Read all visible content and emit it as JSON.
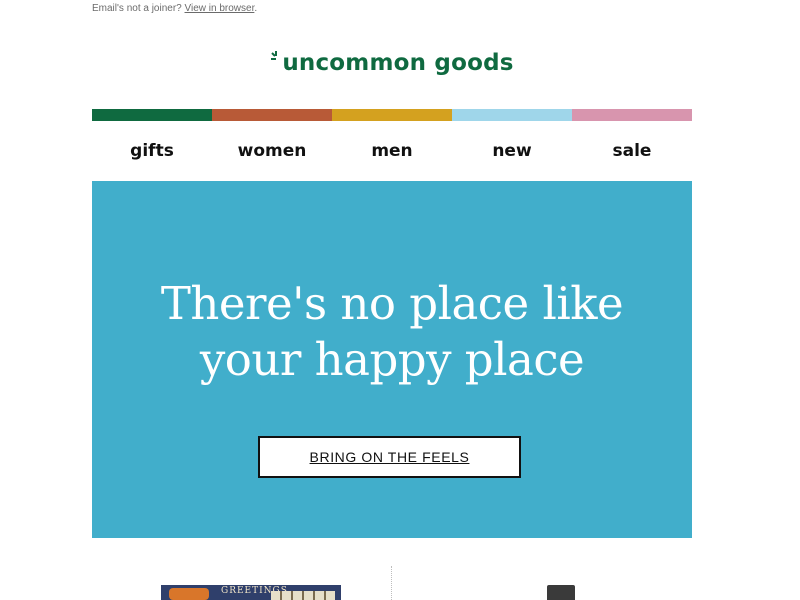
{
  "preheader": {
    "text": "Email's not a joiner?",
    "link": "View in browser",
    "trail": "."
  },
  "logo": {
    "text": "uncommon goods",
    "color": "#0f6a40"
  },
  "color_strip": [
    "#0f6a40",
    "#b85a37",
    "#d4a11f",
    "#9fd6ea",
    "#d895ae"
  ],
  "nav": {
    "items": [
      "gifts",
      "women",
      "men",
      "new",
      "sale"
    ]
  },
  "hero": {
    "background": "#41aecb",
    "headline_line1": "There's no place like",
    "headline_line2": "your happy place",
    "cta_label": "BRING ON THE FEELS"
  },
  "products": {
    "left_card_caption": "GREETINGS"
  }
}
